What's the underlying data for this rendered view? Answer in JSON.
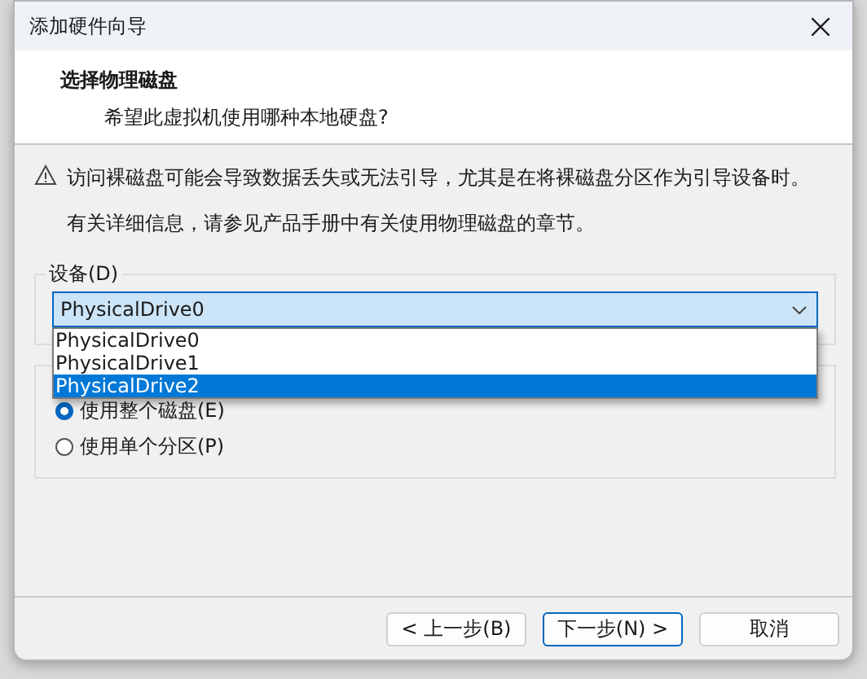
{
  "window": {
    "title": "添加硬件向导"
  },
  "header": {
    "title": "选择物理磁盘",
    "subtitle": "希望此虚拟机使用哪种本地硬盘?"
  },
  "warning": "访问裸磁盘可能会导致数据丢失或无法引导，尤其是在将裸磁盘分区作为引导设备时。",
  "info": "有关详细信息，请参见产品手册中有关使用物理磁盘的章节。",
  "device": {
    "label": "设备(D)",
    "value": "PhysicalDrive0",
    "expanded": true,
    "options": [
      {
        "label": "PhysicalDrive0",
        "highlighted": false
      },
      {
        "label": "PhysicalDrive1",
        "highlighted": false
      },
      {
        "label": "PhysicalDrive2",
        "highlighted": true
      }
    ]
  },
  "usage": [
    {
      "label": "使用整个磁盘(E)",
      "selected": true
    },
    {
      "label": "使用单个分区(P)",
      "selected": false
    }
  ],
  "buttons": [
    {
      "label": "< 上一步(B)",
      "default": false
    },
    {
      "label": "下一步(N) >",
      "default": true
    },
    {
      "label": "取消",
      "default": false
    }
  ]
}
